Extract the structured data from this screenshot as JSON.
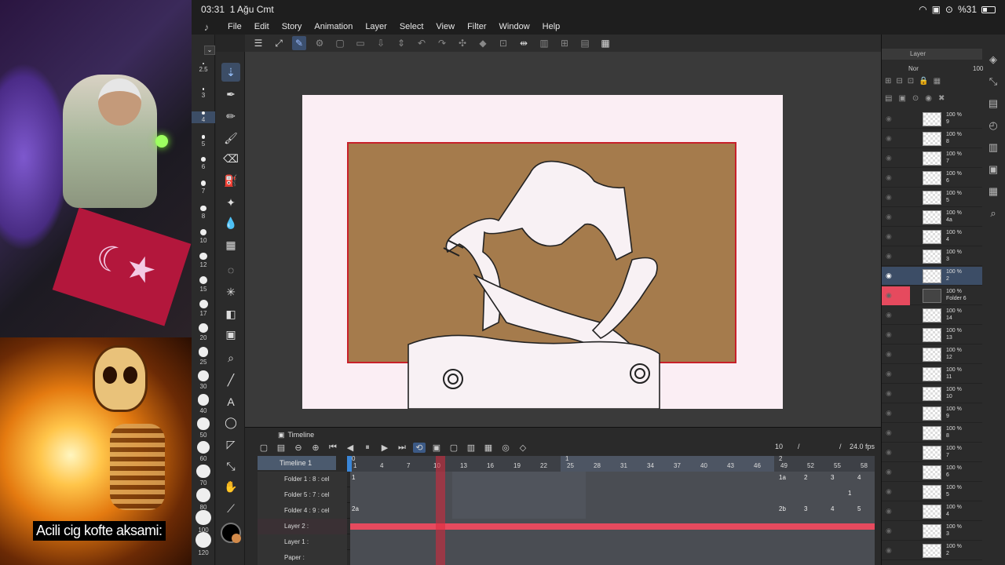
{
  "status": {
    "time": "03:31",
    "date": "1 Ağu Cmt",
    "battery": "%31"
  },
  "menu": [
    "File",
    "Edit",
    "Story",
    "Animation",
    "Layer",
    "Select",
    "View",
    "Filter",
    "Window",
    "Help"
  ],
  "sizes": [
    "2.5",
    "3",
    "4",
    "5",
    "6",
    "7",
    "8",
    "10",
    "12",
    "15",
    "17",
    "20",
    "25",
    "30",
    "40",
    "50",
    "60",
    "70",
    "80",
    "100",
    "120"
  ],
  "caption": "Acili cig kofte aksami:",
  "timeline": {
    "tab": "Timeline",
    "name": "Timeline 1",
    "current_frame": "10",
    "slash": "/",
    "slash2": "/",
    "fps": "24.0 fps",
    "ruler": [
      "1",
      "4",
      "7",
      "10",
      "13",
      "16",
      "19",
      "22",
      "25",
      "28",
      "31",
      "34",
      "37",
      "40",
      "43",
      "46",
      "49",
      "52",
      "55",
      "58"
    ],
    "ruler_marks": [
      "0",
      "1",
      "2"
    ],
    "tracks": [
      {
        "name": "Folder 1 : 8 : cel",
        "cells": [
          "1",
          "1a",
          "2",
          "3",
          "4"
        ]
      },
      {
        "name": "Folder 5 : 7 : cel",
        "cells": [
          "1"
        ]
      },
      {
        "name": "Folder 4 : 9 : cel",
        "cells": [
          "2a",
          "2b",
          "3",
          "4",
          "5"
        ]
      },
      {
        "name": "Layer 2 :",
        "cells": []
      },
      {
        "name": "Layer 1 :",
        "cells": []
      },
      {
        "name": "Paper :",
        "cells": []
      }
    ]
  },
  "panel": {
    "tab": "Layer",
    "blend": "Nor",
    "opacity": "100",
    "layers": [
      {
        "pct": "100 %",
        "name": "9"
      },
      {
        "pct": "100 %",
        "name": "8"
      },
      {
        "pct": "100 %",
        "name": "7"
      },
      {
        "pct": "100 %",
        "name": "6"
      },
      {
        "pct": "100 %",
        "name": "5"
      },
      {
        "pct": "100 %",
        "name": "4a"
      },
      {
        "pct": "100 %",
        "name": "4"
      },
      {
        "pct": "100 %",
        "name": "3"
      },
      {
        "pct": "100 %",
        "name": "2"
      },
      {
        "pct": "100 %",
        "name": "Folder 6"
      },
      {
        "pct": "100 %",
        "name": "14"
      },
      {
        "pct": "100 %",
        "name": "13"
      },
      {
        "pct": "100 %",
        "name": "12"
      },
      {
        "pct": "100 %",
        "name": "11"
      },
      {
        "pct": "100 %",
        "name": "10"
      },
      {
        "pct": "100 %",
        "name": "9"
      },
      {
        "pct": "100 %",
        "name": "8"
      },
      {
        "pct": "100 %",
        "name": "7"
      },
      {
        "pct": "100 %",
        "name": "6"
      },
      {
        "pct": "100 %",
        "name": "5"
      },
      {
        "pct": "100 %",
        "name": "4"
      },
      {
        "pct": "100 %",
        "name": "3"
      },
      {
        "pct": "100 %",
        "name": "2"
      }
    ]
  }
}
